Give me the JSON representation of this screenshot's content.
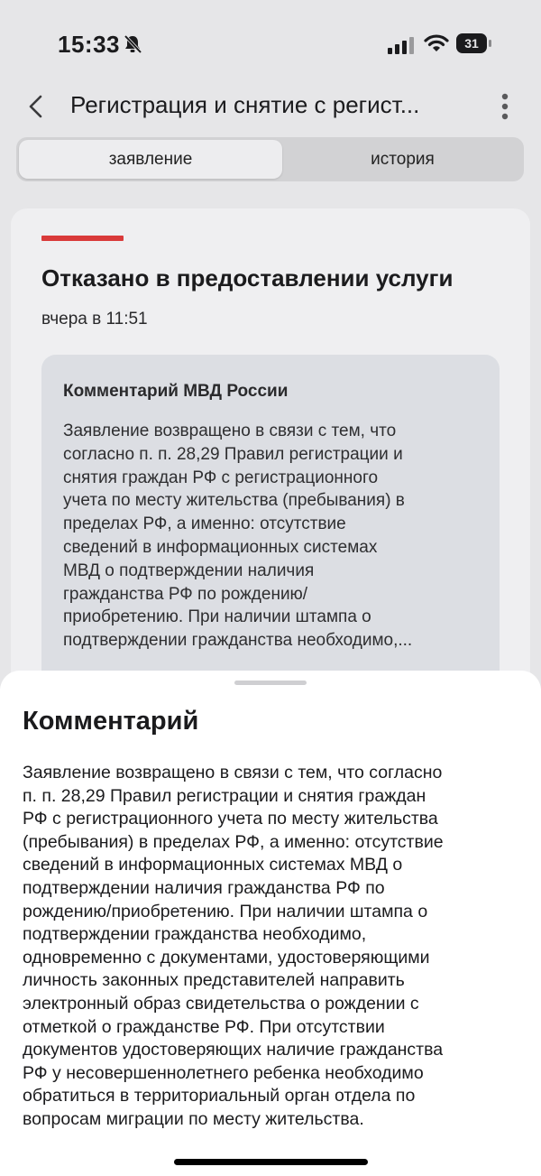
{
  "status_bar": {
    "time": "15:33",
    "battery": "31"
  },
  "header": {
    "title": "Регистрация и снятие с регист..."
  },
  "tabs": [
    {
      "label": "заявление",
      "active": true
    },
    {
      "label": "история",
      "active": false
    }
  ],
  "card": {
    "accent_color": "#d93a3a",
    "status": "Отказано в предоставлении услуги",
    "date": "вчера в 11:51",
    "comment_heading": "Комментарий МВД России",
    "comment_lines": [
      "Заявление возвращено в связи с тем, что",
      "согласно п. п. 28,29 Правил регистрации и",
      "снятия граждан РФ с регистрационного",
      "учета по месту жительства (пребывания) в",
      "пределах РФ, а именно: отсутствие",
      "сведений в информационных системах",
      "МВД о подтверждении наличия",
      "гражданства РФ по рождению/",
      "приобретению. При наличии штампа о",
      "подтверждении гражданства необходимо,..."
    ]
  },
  "sheet": {
    "title": "Комментарий",
    "lines": [
      "Заявление возвращено в связи с тем, что согласно",
      "п. п. 28,29 Правил регистрации и снятия граждан",
      "РФ с регистрационного учета по месту жительства",
      "(пребывания) в пределах РФ, а именно: отсутствие",
      "сведений в информационных системах МВД о",
      "подтверждении наличия гражданства РФ по",
      "рождению/приобретению. При наличии штампа о",
      "подтверждении гражданства необходимо,",
      "одновременно с документами, удостоверяющими",
      "личность законных представителей направить",
      "электронный образ свидетельства о рождении с",
      "отметкой о гражданстве РФ. При отсутствии",
      "документов удостоверяющих наличие гражданства",
      "РФ у несовершеннолетнего ребенка необходимо",
      "обратиться в территориальный орган отдела по",
      "вопросам миграции по месту жительства."
    ]
  },
  "icons": {
    "back": "chevron-left-icon",
    "more": "more-vertical-icon",
    "bell": "bell-slash-icon",
    "signal": "cellular-signal-icon",
    "wifi": "wifi-icon"
  }
}
